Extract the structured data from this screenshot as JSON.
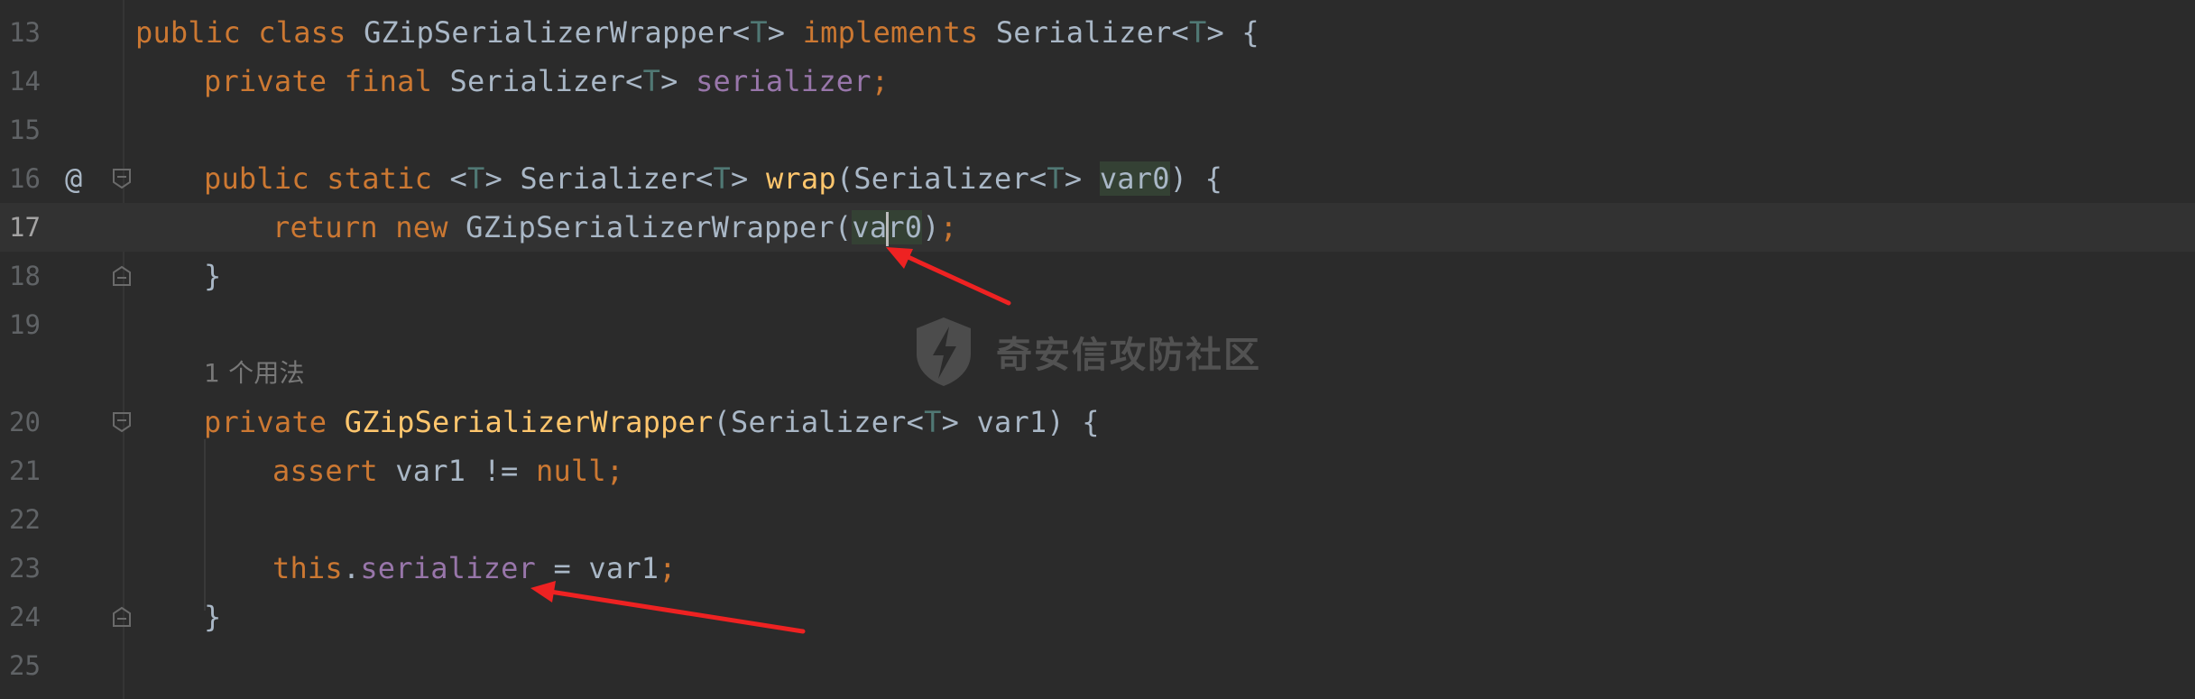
{
  "editor": {
    "lines": [
      {
        "number": "13"
      },
      {
        "number": "14"
      },
      {
        "number": "15"
      },
      {
        "number": "16"
      },
      {
        "number": "17"
      },
      {
        "number": "18"
      },
      {
        "number": "19"
      },
      {
        "number": "20"
      },
      {
        "number": "21"
      },
      {
        "number": "22"
      },
      {
        "number": "23"
      },
      {
        "number": "24"
      },
      {
        "number": "25"
      }
    ],
    "code": {
      "l13": {
        "kw1": "public class ",
        "name": "GZipSerializerWrapper<",
        "t1": "T",
        "mid": "> ",
        "kw2": "implements ",
        "iface": "Serializer<",
        "t2": "T",
        "end": "> {"
      },
      "l14": {
        "kw": "private final ",
        "type": "Serializer<",
        "t": "T",
        "gt": "> ",
        "field": "serializer",
        "semi": ";"
      },
      "l16": {
        "kw": "public static ",
        "lt": "<",
        "t1": "T",
        "gt": "> Serializer<",
        "t2": "T",
        "gt2": "> ",
        "fn": "wrap",
        "p1": "(Serializer<",
        "t3": "T",
        "gt3": "> ",
        "param": "var0",
        "end": ") {"
      },
      "l17": {
        "kw": "return new ",
        "cls": "GZipSerializerWrapper(",
        "arg_a": "va",
        "arg_b": "r0",
        "close": ")",
        "semi": ";"
      },
      "l18": {
        "brace": "}"
      },
      "hint": "1 个用法",
      "l20": {
        "kw": "private ",
        "fn": "GZipSerializerWrapper",
        "p1": "(Serializer<",
        "t": "T",
        "end": "> var1) {"
      },
      "l21": {
        "kw": "assert ",
        "mid": "var1 != ",
        "nul": "null",
        "semi": ";"
      },
      "l23": {
        "kw": "this",
        "dot": ".",
        "field": "serializer",
        "mid": " = var1",
        "semi": ";"
      },
      "l24": {
        "brace": "}"
      }
    },
    "gutter": {
      "override_marker": "@"
    }
  },
  "watermark": {
    "text": "奇安信攻防社区"
  },
  "colors": {
    "background": "#2b2b2b",
    "keyword": "#cc7832",
    "field": "#9876aa",
    "method": "#ffc66d",
    "arrow": "#ee2222"
  }
}
